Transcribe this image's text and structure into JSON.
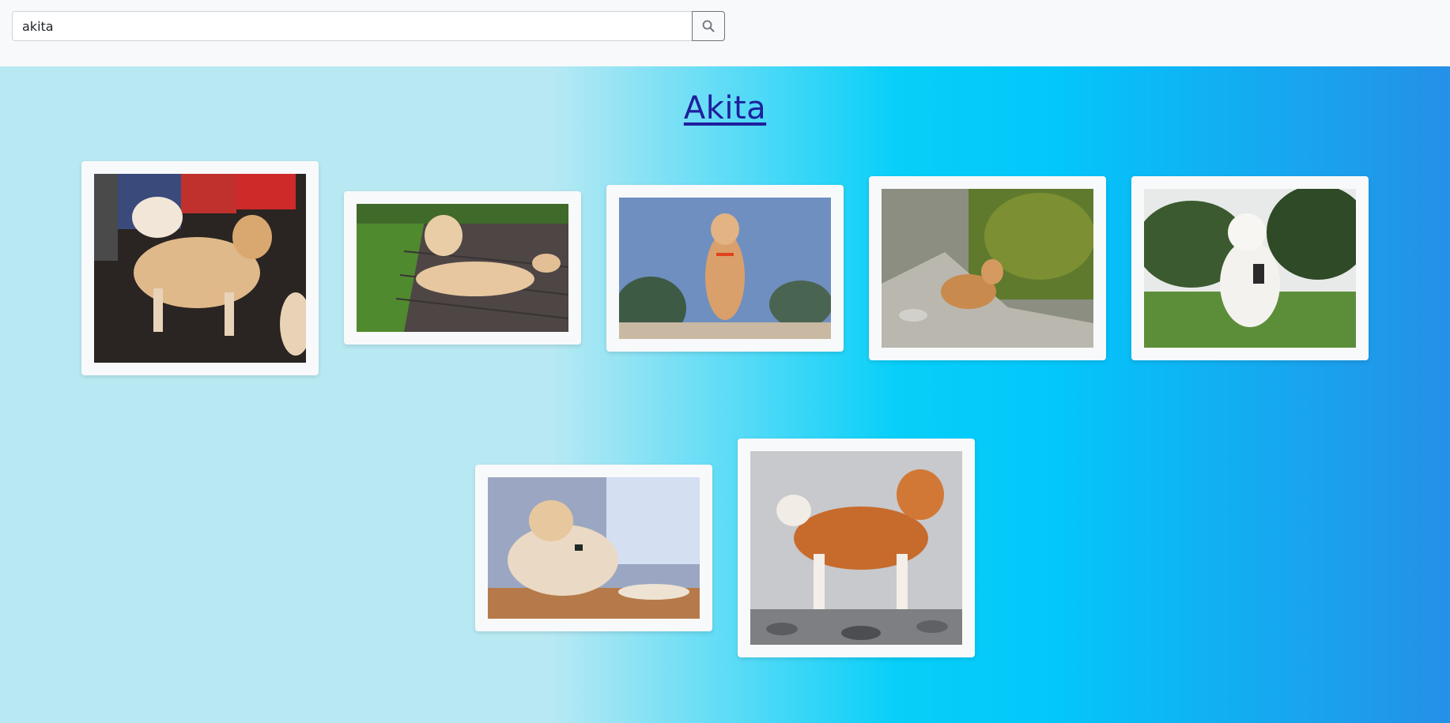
{
  "search": {
    "value": "akita",
    "button_icon": "search-icon"
  },
  "breed": {
    "title": "Akita"
  },
  "gallery": {
    "image_count": 7
  },
  "colors": {
    "title_link": "#1f1f9e",
    "card_background": "#f8f9fa",
    "gradient_start": "#b8e9f3",
    "gradient_mid": "#06cff9",
    "gradient_end": "#2590e7"
  }
}
